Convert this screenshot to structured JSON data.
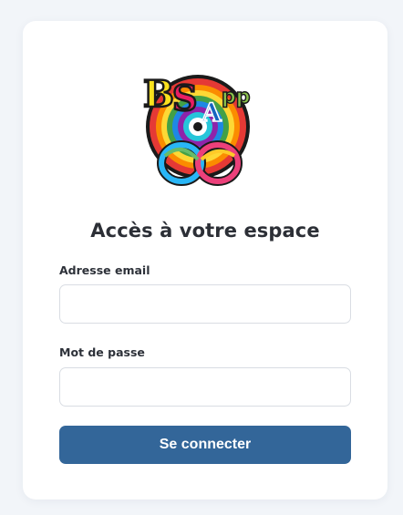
{
  "logo": {
    "text_b": "B",
    "text_s": "S",
    "text_a": "A",
    "text_pp": "pp"
  },
  "form": {
    "title": "Accès à votre espace",
    "email_label": "Adresse email",
    "email_value": "",
    "email_placeholder": "",
    "password_label": "Mot de passe",
    "password_value": "",
    "password_placeholder": "",
    "submit_label": "Se connecter"
  },
  "colors": {
    "background": "#f2f5f9",
    "card": "#ffffff",
    "accent": "#336699",
    "text": "#2c2f36",
    "border": "#d9dde3"
  }
}
